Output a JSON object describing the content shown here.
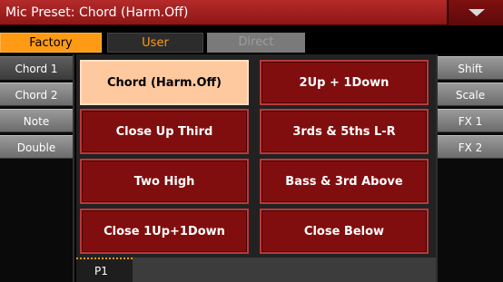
{
  "title": "Mic Preset: Chord (Harm.Off)",
  "colors": {
    "accent": "#ff9a14",
    "preset_bg": "#800e0e",
    "selected_bg": "#ffc9a0",
    "title_bg": "#a32020"
  },
  "top_tabs": [
    {
      "label": "Factory",
      "state": "active"
    },
    {
      "label": "User",
      "state": "normal"
    },
    {
      "label": "Direct",
      "state": "disabled"
    }
  ],
  "left_tabs": [
    {
      "label": "Chord 1",
      "active": true
    },
    {
      "label": "Chord 2",
      "active": false
    },
    {
      "label": "Note",
      "active": false
    },
    {
      "label": "Double",
      "active": false
    }
  ],
  "right_tabs": [
    {
      "label": "Shift"
    },
    {
      "label": "Scale"
    },
    {
      "label": "FX 1"
    },
    {
      "label": "FX 2"
    }
  ],
  "presets": [
    {
      "label": "Chord (Harm.Off)",
      "selected": true
    },
    {
      "label": "2Up + 1Down",
      "selected": false
    },
    {
      "label": "Close Up Third",
      "selected": false
    },
    {
      "label": "3rds & 5ths L-R",
      "selected": false
    },
    {
      "label": "Two High",
      "selected": false
    },
    {
      "label": "Bass & 3rd Above",
      "selected": false
    },
    {
      "label": "Close 1Up+1Down",
      "selected": false
    },
    {
      "label": "Close Below",
      "selected": false
    }
  ],
  "pages": [
    {
      "label": "P1",
      "active": true
    }
  ],
  "icons": {
    "menu": "triangle-down-icon"
  }
}
